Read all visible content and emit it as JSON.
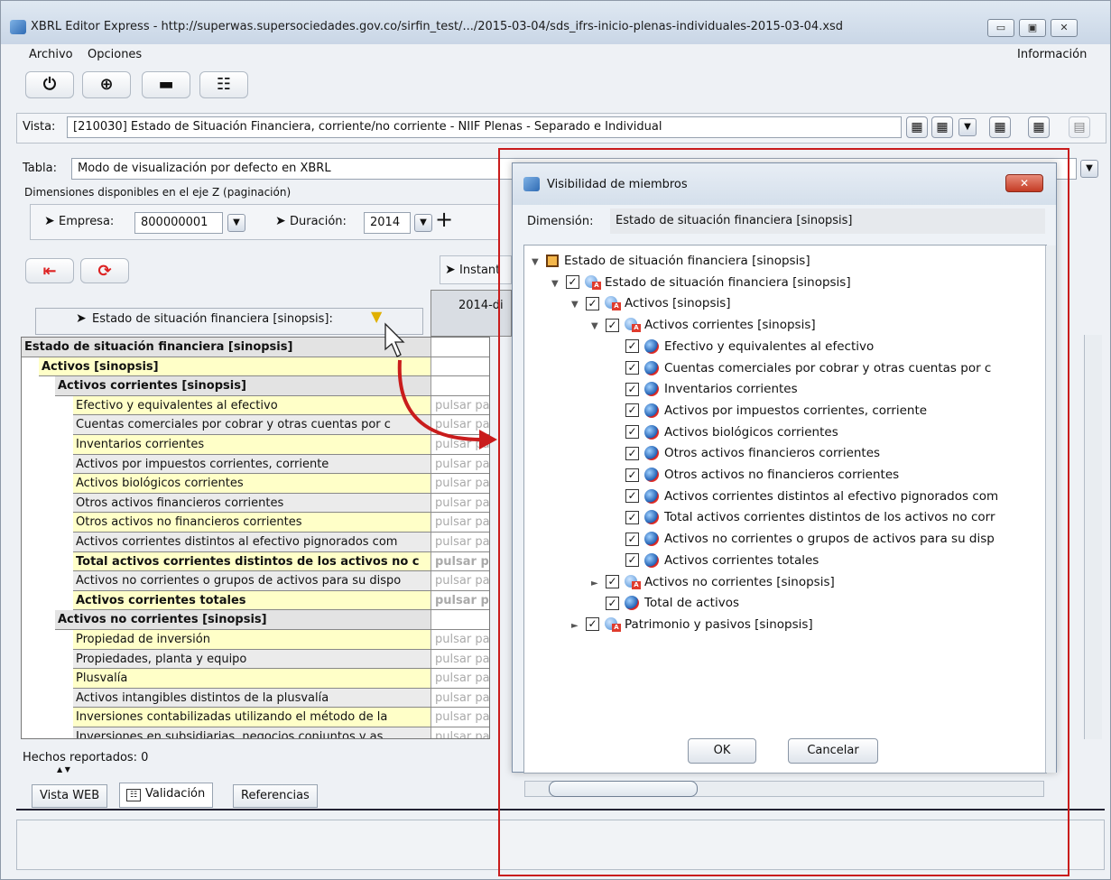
{
  "window": {
    "title": "XBRL Editor Express - http://superwas.supersociedades.gov.co/sirfin_test/.../2015-03-04/sds_ifrs-inicio-plenas-individuales-2015-03-04.xsd",
    "btn_min": "▭",
    "btn_max": "▣",
    "btn_close": "✕"
  },
  "menu": {
    "archivo": "Archivo",
    "opciones": "Opciones",
    "informacion": "Información"
  },
  "toolbar": {
    "power": "⏻",
    "export": "⊕",
    "print": "▬",
    "form": "☷"
  },
  "vista": {
    "label": "Vista:",
    "value": "[210030] Estado de Situación Financiera, corriente/no corriente - NIIF Plenas - Separado e Individual"
  },
  "tabla": {
    "label": "Tabla:",
    "value": "Modo de visualización por defecto en XBRL",
    "dims_caption": "Dimensiones disponibles en el eje Z (paginación)"
  },
  "zaxis": {
    "empresa_label": "Empresa:",
    "empresa_value": "800000001",
    "duracion_label": "Duración:",
    "duracion_value": "2014",
    "add": "+"
  },
  "instant_label": "Instant",
  "column_header": "2014-di",
  "row_header": "Estado de situación financiera [sinopsis]:",
  "placeholder": "pulsar para",
  "rows": [
    {
      "label": "Estado de situación financiera [sinopsis]",
      "level": 0,
      "style": "head"
    },
    {
      "label": "Activos [sinopsis]",
      "level": 1,
      "style": "yellow-bold"
    },
    {
      "label": "Activos corrientes [sinopsis]",
      "level": 2,
      "style": "head"
    },
    {
      "label": "Efectivo y equivalentes al efectivo",
      "level": 3,
      "style": "yellow"
    },
    {
      "label": "Cuentas comerciales por cobrar y otras cuentas por c",
      "level": 3,
      "style": "grey"
    },
    {
      "label": "Inventarios corrientes",
      "level": 3,
      "style": "yellow"
    },
    {
      "label": "Activos por impuestos corrientes, corriente",
      "level": 3,
      "style": "grey"
    },
    {
      "label": "Activos biológicos corrientes",
      "level": 3,
      "style": "yellow"
    },
    {
      "label": "Otros activos financieros corrientes",
      "level": 3,
      "style": "grey"
    },
    {
      "label": "Otros activos no financieros corrientes",
      "level": 3,
      "style": "yellow"
    },
    {
      "label": "Activos corrientes distintos al efectivo pignorados com",
      "level": 3,
      "style": "grey"
    },
    {
      "label": "Total activos corrientes distintos de los activos no c",
      "level": 3,
      "style": "yellow-bold"
    },
    {
      "label": "Activos no corrientes o grupos de activos para su dispo",
      "level": 3,
      "style": "grey"
    },
    {
      "label": "Activos corrientes totales",
      "level": 3,
      "style": "yellow-bold"
    },
    {
      "label": "Activos no corrientes [sinopsis]",
      "level": 2,
      "style": "head"
    },
    {
      "label": "Propiedad de inversión",
      "level": 3,
      "style": "yellow"
    },
    {
      "label": "Propiedades, planta y equipo",
      "level": 3,
      "style": "grey"
    },
    {
      "label": "Plusvalía",
      "level": 3,
      "style": "yellow"
    },
    {
      "label": "Activos intangibles distintos de la plusvalía",
      "level": 3,
      "style": "grey"
    },
    {
      "label": "Inversiones contabilizadas utilizando el método de la",
      "level": 3,
      "style": "yellow"
    },
    {
      "label": "Inversiones en subsidiarias, negocios conjuntos y as",
      "level": 3,
      "style": "grey"
    }
  ],
  "status": {
    "hechos": "Hechos reportados: 0"
  },
  "bottom_tabs": [
    "Vista WEB",
    "Validación",
    "Referencias"
  ],
  "dialog": {
    "title": "Visibilidad de miembros",
    "close": "✕",
    "dimension_label": "Dimensión:",
    "dimension_value": "Estado de situación financiera [sinopsis]",
    "ok": "OK",
    "cancel": "Cancelar",
    "tree": [
      {
        "label": "Estado de situación financiera [sinopsis]",
        "level": 0,
        "expander": "▼",
        "kind": "root",
        "checked": false
      },
      {
        "label": "Estado de situación financiera [sinopsis]",
        "level": 1,
        "expander": "▼",
        "kind": "abstract",
        "checked": true
      },
      {
        "label": "Activos [sinopsis]",
        "level": 2,
        "expander": "▼",
        "kind": "abstract",
        "checked": true
      },
      {
        "label": "Activos corrientes [sinopsis]",
        "level": 3,
        "expander": "▼",
        "kind": "abstract",
        "checked": true
      },
      {
        "label": "Efectivo y equivalentes al efectivo",
        "level": 4,
        "expander": "",
        "kind": "leaf",
        "checked": true
      },
      {
        "label": "Cuentas comerciales por cobrar y otras cuentas por c",
        "level": 4,
        "expander": "",
        "kind": "leaf",
        "checked": true
      },
      {
        "label": "Inventarios corrientes",
        "level": 4,
        "expander": "",
        "kind": "leaf",
        "checked": true
      },
      {
        "label": "Activos por impuestos corrientes, corriente",
        "level": 4,
        "expander": "",
        "kind": "leaf",
        "checked": true
      },
      {
        "label": "Activos biológicos corrientes",
        "level": 4,
        "expander": "",
        "kind": "leaf",
        "checked": true
      },
      {
        "label": "Otros activos financieros corrientes",
        "level": 4,
        "expander": "",
        "kind": "leaf",
        "checked": true
      },
      {
        "label": "Otros activos no financieros corrientes",
        "level": 4,
        "expander": "",
        "kind": "leaf",
        "checked": true
      },
      {
        "label": "Activos corrientes distintos al efectivo pignorados com",
        "level": 4,
        "expander": "",
        "kind": "leaf",
        "checked": true
      },
      {
        "label": "Total activos corrientes distintos de los activos no corr",
        "level": 4,
        "expander": "",
        "kind": "leaf",
        "checked": true
      },
      {
        "label": "Activos no corrientes o grupos de activos para su disp",
        "level": 4,
        "expander": "",
        "kind": "leaf",
        "checked": true
      },
      {
        "label": "Activos corrientes totales",
        "level": 4,
        "expander": "",
        "kind": "leaf",
        "checked": true
      },
      {
        "label": "Activos no corrientes [sinopsis]",
        "level": 3,
        "expander": "►",
        "kind": "abstract",
        "checked": true
      },
      {
        "label": "Total de activos",
        "level": 3,
        "expander": "",
        "kind": "leaf",
        "checked": true
      },
      {
        "label": "Patrimonio y pasivos [sinopsis]",
        "level": 2,
        "expander": "►",
        "kind": "abstract",
        "checked": true
      }
    ]
  },
  "colors": {
    "highlight_red": "#c91c1c",
    "row_yellow": "#ffffc8",
    "row_grey": "#ebebeb"
  }
}
